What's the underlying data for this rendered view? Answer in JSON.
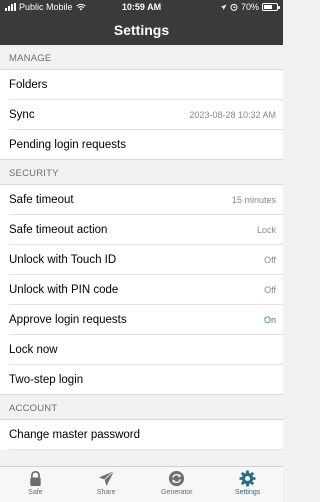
{
  "status_bar": {
    "carrier": "Public Mobile",
    "time": "10:59 AM",
    "battery": "70%",
    "battery_level": 0.7
  },
  "nav": {
    "title": "Settings"
  },
  "sections": {
    "manage": {
      "title": "MANAGE",
      "folders": "Folders",
      "sync": "Sync",
      "sync_value": "2023-08-28 10:32 AM",
      "pending": "Pending login requests"
    },
    "security": {
      "title": "SECURITY",
      "safe_timeout": "Safe timeout",
      "safe_timeout_value": "15 minutes",
      "timeout_action": "Safe timeout action",
      "timeout_action_value": "Lock",
      "touch_id": "Unlock with Touch ID",
      "touch_id_value": "Off",
      "pin": "Unlock with PIN code",
      "pin_value": "Off",
      "approve": "Approve login requests",
      "approve_value": "On",
      "lock_now": "Lock now",
      "two_step": "Two-step login"
    },
    "account": {
      "title": "ACCOUNT",
      "change_pw": "Change master password"
    }
  },
  "tabs": {
    "safe": "Safe",
    "share": "Share",
    "generator": "Generator",
    "settings": "Settings",
    "icons": [
      "lock-icon",
      "send-icon",
      "refresh-icon",
      "gear-icon"
    ],
    "active": "settings",
    "active_color": "#2b6e83",
    "inactive_color": "#6d6d72"
  },
  "colors": {
    "header_bg": "#3a3a3c",
    "on_color": "#2e8b57"
  }
}
